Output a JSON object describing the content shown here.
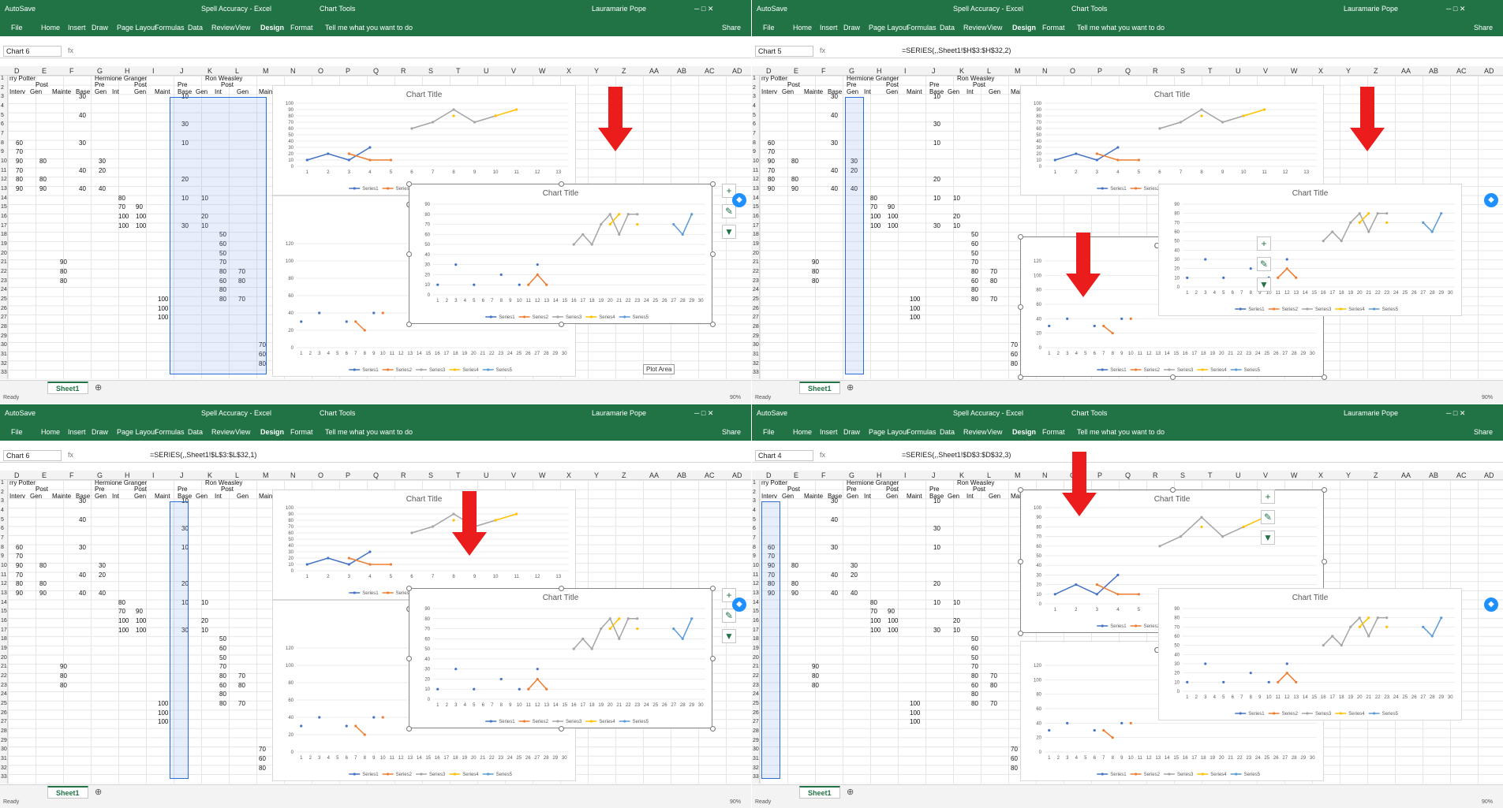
{
  "app": {
    "autosave": "AutoSave",
    "title": "Spell Accuracy  -  Excel",
    "chart_tools": "Chart Tools",
    "user": "Lauramarie Pope",
    "share": "Share",
    "tell_me": "Tell me what you want to do",
    "tabs": [
      "File",
      "Home",
      "Insert",
      "Draw",
      "Page Layout",
      "Formulas",
      "Data",
      "Review",
      "View",
      "Design",
      "Format"
    ],
    "sheet_tab": "Sheet1",
    "status_ready": "Ready",
    "zoom": "90%",
    "fx": "fx"
  },
  "panes": [
    {
      "namebox": "Chart 6",
      "formula": ""
    },
    {
      "namebox": "Chart 5",
      "formula": "=SERIES(,,Sheet1!$H$3:$H$32,2)"
    },
    {
      "namebox": "Chart 6",
      "formula": "=SERIES(,,Sheet1!$L$3:$L$32,1)"
    },
    {
      "namebox": "Chart 4",
      "formula": "=SERIES(,,Sheet1!$D$3:$D$32,3)"
    }
  ],
  "columns": [
    "D",
    "E",
    "F",
    "G",
    "H",
    "I",
    "J",
    "K",
    "L",
    "M",
    "N",
    "O",
    "P",
    "Q",
    "R",
    "S",
    "T",
    "U",
    "V",
    "W",
    "X",
    "Y",
    "Z",
    "AA",
    "AB",
    "AC",
    "AD"
  ],
  "headers": {
    "harry": "rry Potter",
    "hermione": "Hermione Granger",
    "ron": "Ron Weasley",
    "pre": "Pre",
    "post": "Post",
    "row2": [
      "Interv",
      "Gen",
      "Mainte",
      "Base",
      "Gen",
      "Int",
      "Gen",
      "Maint",
      "Base",
      "Gen",
      "Int",
      "Gen",
      "Maint"
    ]
  },
  "cells": {
    "colD": [
      "60",
      "70",
      "90",
      "70",
      "80",
      "90"
    ],
    "colE": [
      "80",
      "80",
      "90"
    ],
    "colF": [
      "90",
      "80",
      "80"
    ],
    "colG": [
      "30",
      "40",
      "30",
      "40",
      "40"
    ],
    "colH": [
      "30",
      "20",
      "40"
    ],
    "colI": [
      "80",
      "70",
      "100",
      "100"
    ],
    "colJ": [
      "90",
      "100",
      "100"
    ],
    "colK": [
      "100",
      "100",
      "100"
    ],
    "colL": [
      "10",
      "30",
      "10",
      "20",
      "10",
      "30"
    ],
    "colM": [
      "10",
      "20",
      "10"
    ],
    "colN": [
      "50",
      "60",
      "50",
      "70",
      "80",
      "60",
      "80",
      "80"
    ],
    "colO": [
      "70",
      "80",
      "70"
    ],
    "colP": [
      "70",
      "60",
      "80"
    ]
  },
  "chart_title": "Chart Title",
  "tooltip": "Plot Area",
  "chart_data": [
    {
      "type": "line",
      "title": "Chart Title",
      "chart": "small upper chart",
      "x": [
        1,
        2,
        3,
        4,
        5,
        6,
        7,
        8,
        9,
        10,
        11,
        12,
        13
      ],
      "ylim": [
        0,
        100
      ],
      "yticks": [
        0,
        10,
        20,
        30,
        40,
        50,
        60,
        70,
        80,
        90,
        100
      ],
      "series": [
        {
          "name": "Series1",
          "values": [
            10,
            20,
            10,
            30,
            null,
            null,
            null,
            null,
            null,
            null,
            null,
            null,
            null
          ]
        },
        {
          "name": "Series2",
          "values": [
            null,
            null,
            20,
            10,
            10,
            null,
            null,
            null,
            null,
            null,
            null,
            null,
            null
          ]
        },
        {
          "name": "Series3",
          "values": [
            null,
            null,
            null,
            null,
            null,
            60,
            70,
            90,
            70,
            80,
            null,
            null,
            null
          ]
        },
        {
          "name": "Series4",
          "values": [
            null,
            null,
            null,
            null,
            null,
            null,
            null,
            80,
            null,
            80,
            90,
            null,
            null
          ]
        },
        {
          "name": "Series5",
          "values": [
            null,
            null,
            null,
            null,
            null,
            null,
            null,
            null,
            null,
            null,
            null,
            null,
            null
          ]
        }
      ]
    },
    {
      "type": "line",
      "title": "Chart Title",
      "chart": "lower chart",
      "x": [
        1,
        2,
        3,
        4,
        5,
        6,
        7,
        8,
        9,
        10,
        11,
        12,
        13,
        14,
        15,
        16,
        17,
        18,
        19,
        20,
        21,
        22,
        23,
        24,
        25,
        26,
        27,
        28,
        29,
        30
      ],
      "ylim": [
        0,
        120
      ],
      "yticks": [
        0,
        20,
        40,
        60,
        80,
        100,
        120
      ],
      "series": [
        {
          "name": "Series1",
          "values": [
            30,
            null,
            40,
            null,
            null,
            30,
            null,
            null,
            40,
            null,
            null,
            null,
            null,
            null,
            null,
            null,
            null,
            null,
            null,
            null,
            null,
            null,
            null,
            null,
            null,
            null,
            null,
            null,
            null,
            null
          ]
        },
        {
          "name": "Series2",
          "values": [
            null,
            null,
            null,
            null,
            null,
            null,
            30,
            20,
            null,
            40,
            null,
            null,
            null,
            null,
            null,
            null,
            null,
            null,
            null,
            null,
            null,
            null,
            null,
            null,
            null,
            null,
            null,
            null,
            null,
            null
          ]
        },
        {
          "name": "Series3",
          "values": [
            null,
            null,
            null,
            null,
            null,
            null,
            null,
            null,
            null,
            null,
            null,
            null,
            null,
            null,
            null,
            null,
            null,
            null,
            null,
            null,
            null,
            null,
            null,
            null,
            null,
            null,
            null,
            null,
            null,
            null
          ]
        },
        {
          "name": "Series4",
          "values": [
            null,
            null,
            null,
            null,
            null,
            null,
            null,
            null,
            null,
            null,
            null,
            null,
            null,
            null,
            null,
            null,
            null,
            null,
            null,
            null,
            null,
            null,
            null,
            null,
            null,
            null,
            null,
            null,
            null,
            null
          ]
        },
        {
          "name": "Series5",
          "values": [
            null,
            null,
            null,
            null,
            null,
            null,
            null,
            null,
            null,
            null,
            null,
            null,
            null,
            null,
            null,
            null,
            null,
            null,
            null,
            null,
            null,
            null,
            null,
            null,
            null,
            null,
            null,
            null,
            null,
            null
          ]
        }
      ]
    },
    {
      "type": "line",
      "title": "Chart Title",
      "chart": "floating chart",
      "x": [
        1,
        2,
        3,
        4,
        5,
        6,
        7,
        8,
        9,
        10,
        11,
        12,
        13,
        14,
        15,
        16,
        17,
        18,
        19,
        20,
        21,
        22,
        23,
        24,
        25,
        26,
        27,
        28,
        29,
        30
      ],
      "ylim": [
        0,
        90
      ],
      "yticks": [
        0,
        10,
        20,
        30,
        40,
        50,
        60,
        70,
        80,
        90
      ],
      "series": [
        {
          "name": "Series1",
          "values": [
            10,
            null,
            30,
            null,
            10,
            null,
            null,
            20,
            null,
            10,
            null,
            30,
            null,
            null,
            null,
            null,
            null,
            null,
            null,
            null,
            null,
            null,
            null,
            null,
            null,
            null,
            null,
            null,
            null,
            null
          ]
        },
        {
          "name": "Series2",
          "values": [
            null,
            null,
            null,
            null,
            null,
            null,
            null,
            null,
            null,
            null,
            10,
            20,
            10,
            null,
            null,
            null,
            null,
            null,
            null,
            null,
            null,
            null,
            null,
            null,
            null,
            null,
            null,
            null,
            null,
            null
          ]
        },
        {
          "name": "Series3",
          "values": [
            null,
            null,
            null,
            null,
            null,
            null,
            null,
            null,
            null,
            null,
            null,
            null,
            null,
            null,
            null,
            50,
            60,
            50,
            70,
            80,
            60,
            80,
            80,
            null,
            null,
            null,
            null,
            null,
            null,
            null
          ]
        },
        {
          "name": "Series4",
          "values": [
            null,
            null,
            null,
            null,
            null,
            null,
            null,
            null,
            null,
            null,
            null,
            null,
            null,
            null,
            null,
            null,
            null,
            null,
            null,
            70,
            80,
            null,
            70,
            null,
            null,
            null,
            null,
            null,
            null,
            null
          ]
        },
        {
          "name": "Series5",
          "values": [
            null,
            null,
            null,
            null,
            null,
            null,
            null,
            null,
            null,
            null,
            null,
            null,
            null,
            null,
            null,
            null,
            null,
            null,
            null,
            null,
            null,
            null,
            null,
            null,
            null,
            null,
            70,
            60,
            80,
            null
          ]
        }
      ]
    }
  ]
}
